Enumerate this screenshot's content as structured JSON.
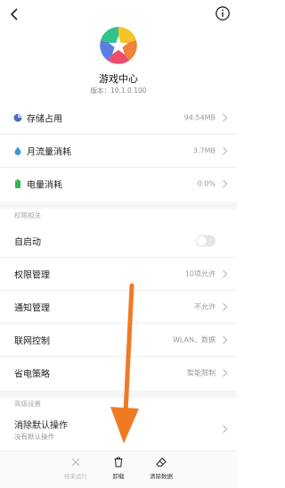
{
  "app": {
    "name": "游戏中心",
    "version": "版本：10.1.0.100"
  },
  "storage_rows": [
    {
      "label": "存储占用",
      "value": "94.54MB"
    },
    {
      "label": "月流量消耗",
      "value": "3.7MB"
    },
    {
      "label": "电量消耗",
      "value": "0.0%"
    }
  ],
  "permissions": {
    "header": "权限相关",
    "autostart_label": "自启动",
    "autostart_on": false,
    "rows": [
      {
        "label": "权限管理",
        "value": "10项允许"
      },
      {
        "label": "通知管理",
        "value": "不允许"
      },
      {
        "label": "联网控制",
        "value": "WLAN、数据"
      },
      {
        "label": "省电策略",
        "value": "智能限制"
      }
    ]
  },
  "advanced": {
    "header": "高级设置",
    "clear_defaults_label": "消除默认操作",
    "clear_defaults_sub": "没有默认操作"
  },
  "bottom_bar": {
    "force_stop": "结束运行",
    "uninstall": "卸载",
    "clear_data": "清除数据"
  },
  "colors": {
    "arrow": "#f07a23",
    "storage_icon": "#4a6fb5",
    "traffic_icon": "#3a9ad9",
    "battery_icon": "#2fb84f"
  }
}
